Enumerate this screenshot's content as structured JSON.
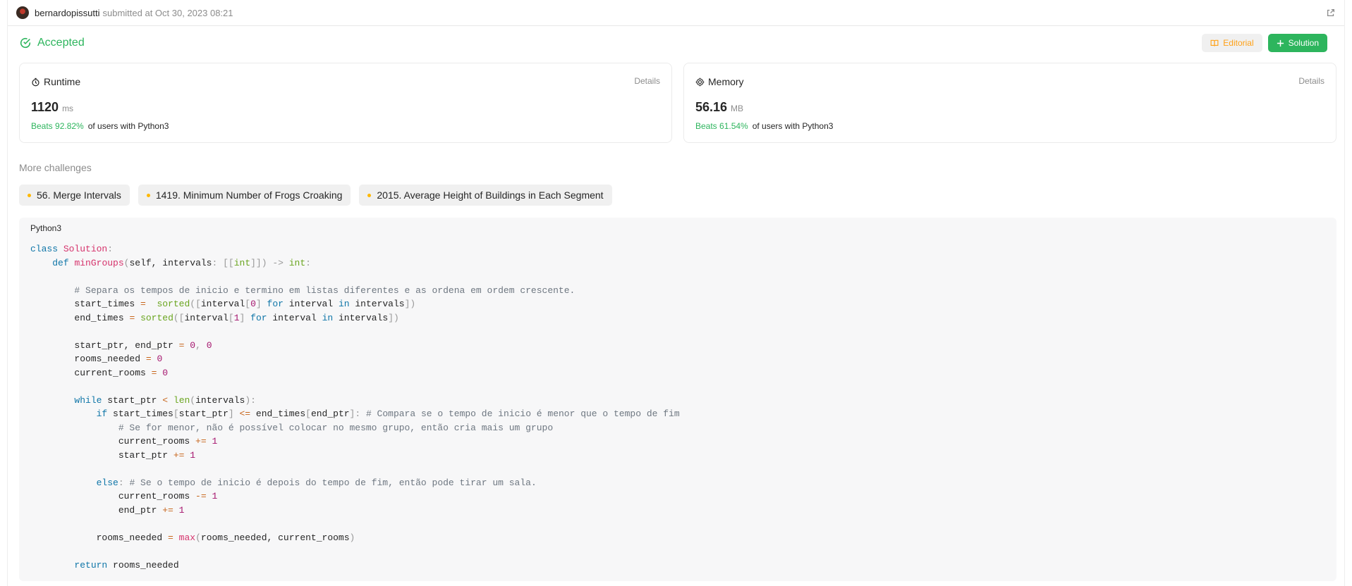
{
  "header": {
    "username": "bernardopissutti",
    "submitted_text": "submitted at Oct 30, 2023 08:21",
    "external_icon": "external-link-icon"
  },
  "status": {
    "text": "Accepted",
    "color": "#2db55d",
    "editorial_label": "Editorial",
    "solution_label": "Solution"
  },
  "runtime": {
    "title": "Runtime",
    "details_label": "Details",
    "value": "1120",
    "unit": "ms",
    "beats": "Beats 92.82%",
    "beats_suffix": "of users with Python3"
  },
  "memory": {
    "title": "Memory",
    "details_label": "Details",
    "value": "56.16",
    "unit": "MB",
    "beats": "Beats 61.54%",
    "beats_suffix": "of users with Python3"
  },
  "more_challenges": {
    "title": "More challenges",
    "items": [
      {
        "label": "56. Merge Intervals"
      },
      {
        "label": "1419. Minimum Number of Frogs Croaking"
      },
      {
        "label": "2015. Average Height of Buildings in Each Segment"
      }
    ]
  },
  "code": {
    "language": "Python3",
    "lines": [
      [
        [
          "kw",
          "class "
        ],
        [
          "cls",
          "Solution"
        ],
        [
          "pn",
          ":"
        ]
      ],
      [
        [
          "",
          "    "
        ],
        [
          "kw",
          "def "
        ],
        [
          "fn",
          "minGroups"
        ],
        [
          "pn",
          "("
        ],
        [
          "",
          "self, intervals"
        ],
        [
          "pn",
          ": [["
        ],
        [
          "bi",
          "int"
        ],
        [
          "pn",
          "]]) -> "
        ],
        [
          "bi",
          "int"
        ],
        [
          "pn",
          ":"
        ]
      ],
      [],
      [
        [
          "",
          "        "
        ],
        [
          "cm",
          "# Separa os tempos de inicio e termino em listas diferentes e as ordena em ordem crescente."
        ]
      ],
      [
        [
          "",
          "        start_times "
        ],
        [
          "op",
          "="
        ],
        [
          "",
          "  "
        ],
        [
          "bi",
          "sorted"
        ],
        [
          "pn",
          "(["
        ],
        [
          "",
          "interval"
        ],
        [
          "pn",
          "["
        ],
        [
          "num",
          "0"
        ],
        [
          "pn",
          "] "
        ],
        [
          "kw",
          "for"
        ],
        [
          "",
          " interval "
        ],
        [
          "kw",
          "in"
        ],
        [
          "",
          " intervals"
        ],
        [
          "pn",
          "])"
        ]
      ],
      [
        [
          "",
          "        end_times "
        ],
        [
          "op",
          "="
        ],
        [
          "",
          " "
        ],
        [
          "bi",
          "sorted"
        ],
        [
          "pn",
          "(["
        ],
        [
          "",
          "interval"
        ],
        [
          "pn",
          "["
        ],
        [
          "num",
          "1"
        ],
        [
          "pn",
          "] "
        ],
        [
          "kw",
          "for"
        ],
        [
          "",
          " interval "
        ],
        [
          "kw",
          "in"
        ],
        [
          "",
          " intervals"
        ],
        [
          "pn",
          "])"
        ]
      ],
      [],
      [
        [
          "",
          "        start_ptr, end_ptr "
        ],
        [
          "op",
          "="
        ],
        [
          "",
          " "
        ],
        [
          "num",
          "0"
        ],
        [
          "pn",
          ", "
        ],
        [
          "num",
          "0"
        ]
      ],
      [
        [
          "",
          "        rooms_needed "
        ],
        [
          "op",
          "="
        ],
        [
          "",
          " "
        ],
        [
          "num",
          "0"
        ]
      ],
      [
        [
          "",
          "        current_rooms "
        ],
        [
          "op",
          "="
        ],
        [
          "",
          " "
        ],
        [
          "num",
          "0"
        ]
      ],
      [],
      [
        [
          "",
          "        "
        ],
        [
          "kw",
          "while"
        ],
        [
          "",
          " start_ptr "
        ],
        [
          "op",
          "<"
        ],
        [
          "",
          " "
        ],
        [
          "bi",
          "len"
        ],
        [
          "pn",
          "("
        ],
        [
          "",
          "intervals"
        ],
        [
          "pn",
          "):"
        ]
      ],
      [
        [
          "",
          "            "
        ],
        [
          "kw",
          "if"
        ],
        [
          "",
          " start_times"
        ],
        [
          "pn",
          "["
        ],
        [
          "",
          "start_ptr"
        ],
        [
          "pn",
          "] "
        ],
        [
          "op",
          "<="
        ],
        [
          "",
          " end_times"
        ],
        [
          "pn",
          "["
        ],
        [
          "",
          "end_ptr"
        ],
        [
          "pn",
          "]: "
        ],
        [
          "cm",
          "# Compara se o tempo de inicio é menor que o tempo de fim"
        ]
      ],
      [
        [
          "",
          "                "
        ],
        [
          "cm",
          "# Se for menor, não é possível colocar no mesmo grupo, então cria mais um grupo"
        ]
      ],
      [
        [
          "",
          "                current_rooms "
        ],
        [
          "op",
          "+="
        ],
        [
          "",
          " "
        ],
        [
          "num",
          "1"
        ]
      ],
      [
        [
          "",
          "                start_ptr "
        ],
        [
          "op",
          "+="
        ],
        [
          "",
          " "
        ],
        [
          "num",
          "1"
        ]
      ],
      [],
      [
        [
          "",
          "            "
        ],
        [
          "kw",
          "else"
        ],
        [
          "pn",
          ": "
        ],
        [
          "cm",
          "# Se o tempo de inicio é depois do tempo de fim, então pode tirar um sala."
        ]
      ],
      [
        [
          "",
          "                current_rooms "
        ],
        [
          "op",
          "-="
        ],
        [
          "",
          " "
        ],
        [
          "num",
          "1"
        ]
      ],
      [
        [
          "",
          "                end_ptr "
        ],
        [
          "op",
          "+="
        ],
        [
          "",
          " "
        ],
        [
          "num",
          "1"
        ]
      ],
      [],
      [
        [
          "",
          "            rooms_needed "
        ],
        [
          "op",
          "="
        ],
        [
          "",
          " "
        ],
        [
          "fn",
          "max"
        ],
        [
          "pn",
          "("
        ],
        [
          "",
          "rooms_needed, current_rooms"
        ],
        [
          "pn",
          ")"
        ]
      ],
      [],
      [
        [
          "",
          "        "
        ],
        [
          "kw",
          "return"
        ],
        [
          "",
          " rooms_needed"
        ]
      ]
    ]
  }
}
